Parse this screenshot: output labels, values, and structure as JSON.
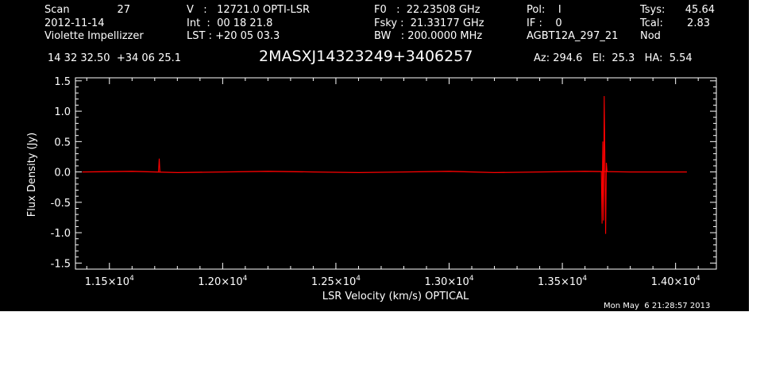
{
  "header": {
    "row1": {
      "scan_label": "Scan",
      "scan_value": "27",
      "v": "V   :   12721.0 OPTI-LSR",
      "f0": "F0   :  22.23508 GHz",
      "pol": "Pol:    I",
      "tsys_label": "Tsys:",
      "tsys_value": "45.64"
    },
    "row2": {
      "date": "2012-11-14",
      "int": "Int  :  00 18 21.8",
      "fsky": "Fsky :  21.33177 GHz",
      "if": "IF :    0",
      "tcal_label": "Tcal:",
      "tcal_value": "2.83"
    },
    "row3": {
      "observer": "Violette Impellizzer",
      "lst": "LST : +20 05 03.3",
      "bw": "BW   : 200.0000 MHz",
      "project": "AGBT12A_297_21",
      "mode": "Nod"
    },
    "coords": "14 32 32.50  +34 06 25.1",
    "source": "2MASXJ14323249+3406257",
    "azel": "Az: 294.6   El:  25.3   HA:  5.54"
  },
  "timestamp": "Mon May  6 21:28:57 2013",
  "chart_data": {
    "type": "line",
    "xlabel": "LSR Velocity (km/s) OPTICAL",
    "ylabel": "Flux Density (Jy)",
    "xlim": [
      11350,
      14180
    ],
    "ylim": [
      -1.6,
      1.55
    ],
    "x_ticks": [
      11500,
      12000,
      12500,
      13000,
      13500,
      14000
    ],
    "x_tick_labels": [
      {
        "mant": "1.15×10",
        "exp": "4"
      },
      {
        "mant": "1.20×10",
        "exp": "4"
      },
      {
        "mant": "1.25×10",
        "exp": "4"
      },
      {
        "mant": "1.30×10",
        "exp": "4"
      },
      {
        "mant": "1.35×10",
        "exp": "4"
      },
      {
        "mant": "1.40×10",
        "exp": "4"
      }
    ],
    "y_ticks": [
      -1.5,
      -1.0,
      -0.5,
      0.0,
      0.5,
      1.0,
      1.5
    ],
    "y_tick_labels": [
      "-1.5",
      "-1.0",
      "-0.5",
      "0.0",
      "0.5",
      "1.0",
      "1.5"
    ],
    "grid": false,
    "series_color": "#ff0000",
    "series": [
      {
        "x": [
          11380,
          11600,
          11800,
          12000,
          12200,
          12400,
          12600,
          12800,
          13000,
          13200,
          13400,
          13600,
          13800,
          14050
        ],
        "y": [
          0.0,
          0.01,
          -0.01,
          0.0,
          0.01,
          0.0,
          -0.01,
          0.0,
          0.01,
          -0.01,
          0.0,
          0.01,
          0.0,
          0.0
        ]
      }
    ],
    "spikes": [
      {
        "x": 11720,
        "y": [
          0.0,
          0.22,
          0.0
        ]
      },
      {
        "x": 13685,
        "y": [
          0.0,
          -0.85,
          0.5,
          -0.8,
          1.25,
          0.2,
          -1.02,
          0.15,
          0.0
        ]
      }
    ]
  }
}
